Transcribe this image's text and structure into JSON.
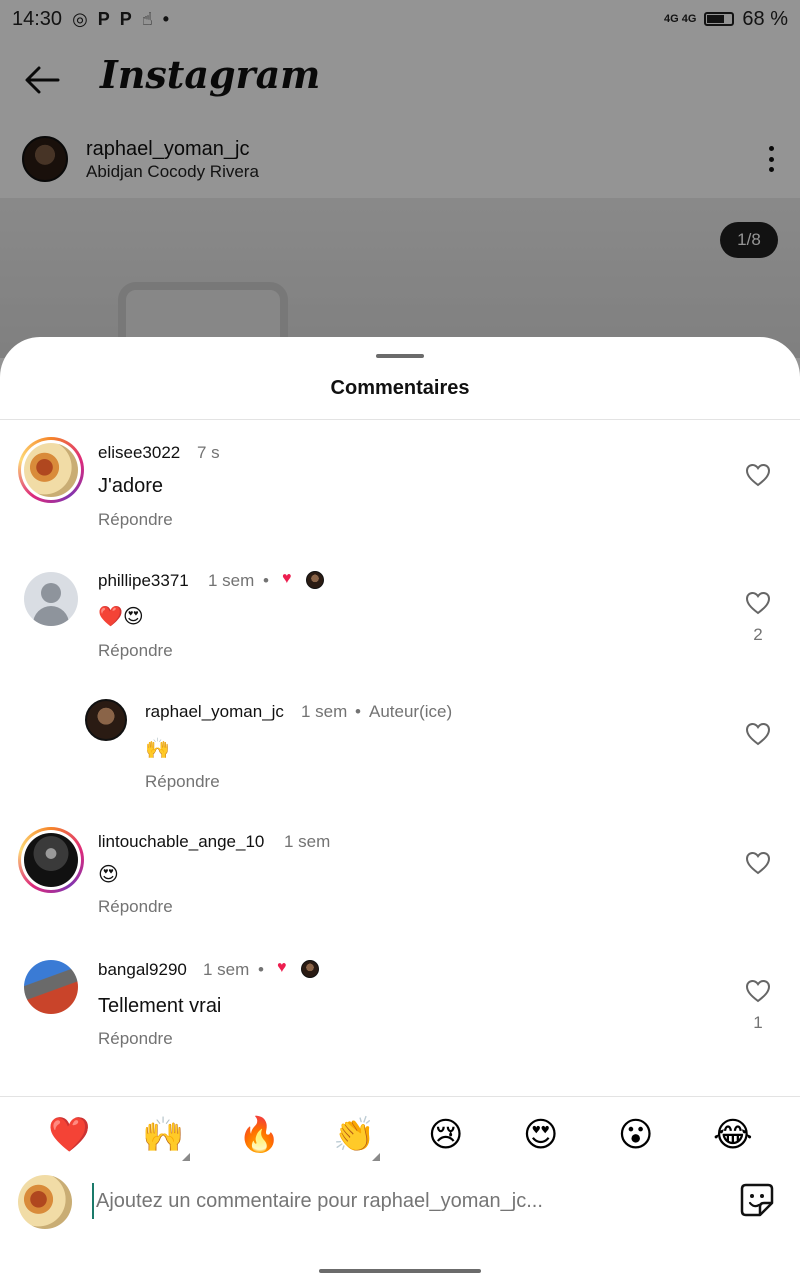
{
  "status_bar": {
    "time": "14:30",
    "network": "4G 4G",
    "battery": "68 %"
  },
  "header": {
    "logo": "Instagram"
  },
  "post": {
    "author": "raphael_yoman_jc",
    "location": "Abidjan Cocody Rivera",
    "page_indicator": "1/8"
  },
  "sheet": {
    "title": "Commentaires"
  },
  "comments": [
    {
      "user": "elisee3022",
      "time": "7 s",
      "text": "J'adore",
      "reply": "Répondre",
      "likes": ""
    },
    {
      "user": "phillipe3371",
      "time": "1 sem",
      "text": "❤️😍",
      "reply": "Répondre",
      "likes": "2"
    },
    {
      "user": "raphael_yoman_jc",
      "time": "1 sem",
      "badge": "Auteur(ice)",
      "text": "🙌",
      "reply": "Répondre",
      "likes": ""
    },
    {
      "user": "lintouchable_ange_10",
      "time": "1 sem",
      "text": "😍",
      "reply": "Répondre",
      "likes": ""
    },
    {
      "user": "bangal9290",
      "time": "1 sem",
      "text": "Tellement vrai",
      "reply": "Répondre",
      "likes": "1"
    }
  ],
  "separator": "•",
  "quick_reactions": [
    "❤️",
    "🙌",
    "🔥",
    "👏",
    "😢",
    "😍",
    "😮",
    "😂"
  ],
  "composer": {
    "placeholder": "Ajoutez un commentaire pour raphael_yoman_jc..."
  },
  "colors": {
    "heart_red": "#ed1e4f",
    "muted_text": "#737373",
    "story_ring": "#dd2a7b"
  }
}
